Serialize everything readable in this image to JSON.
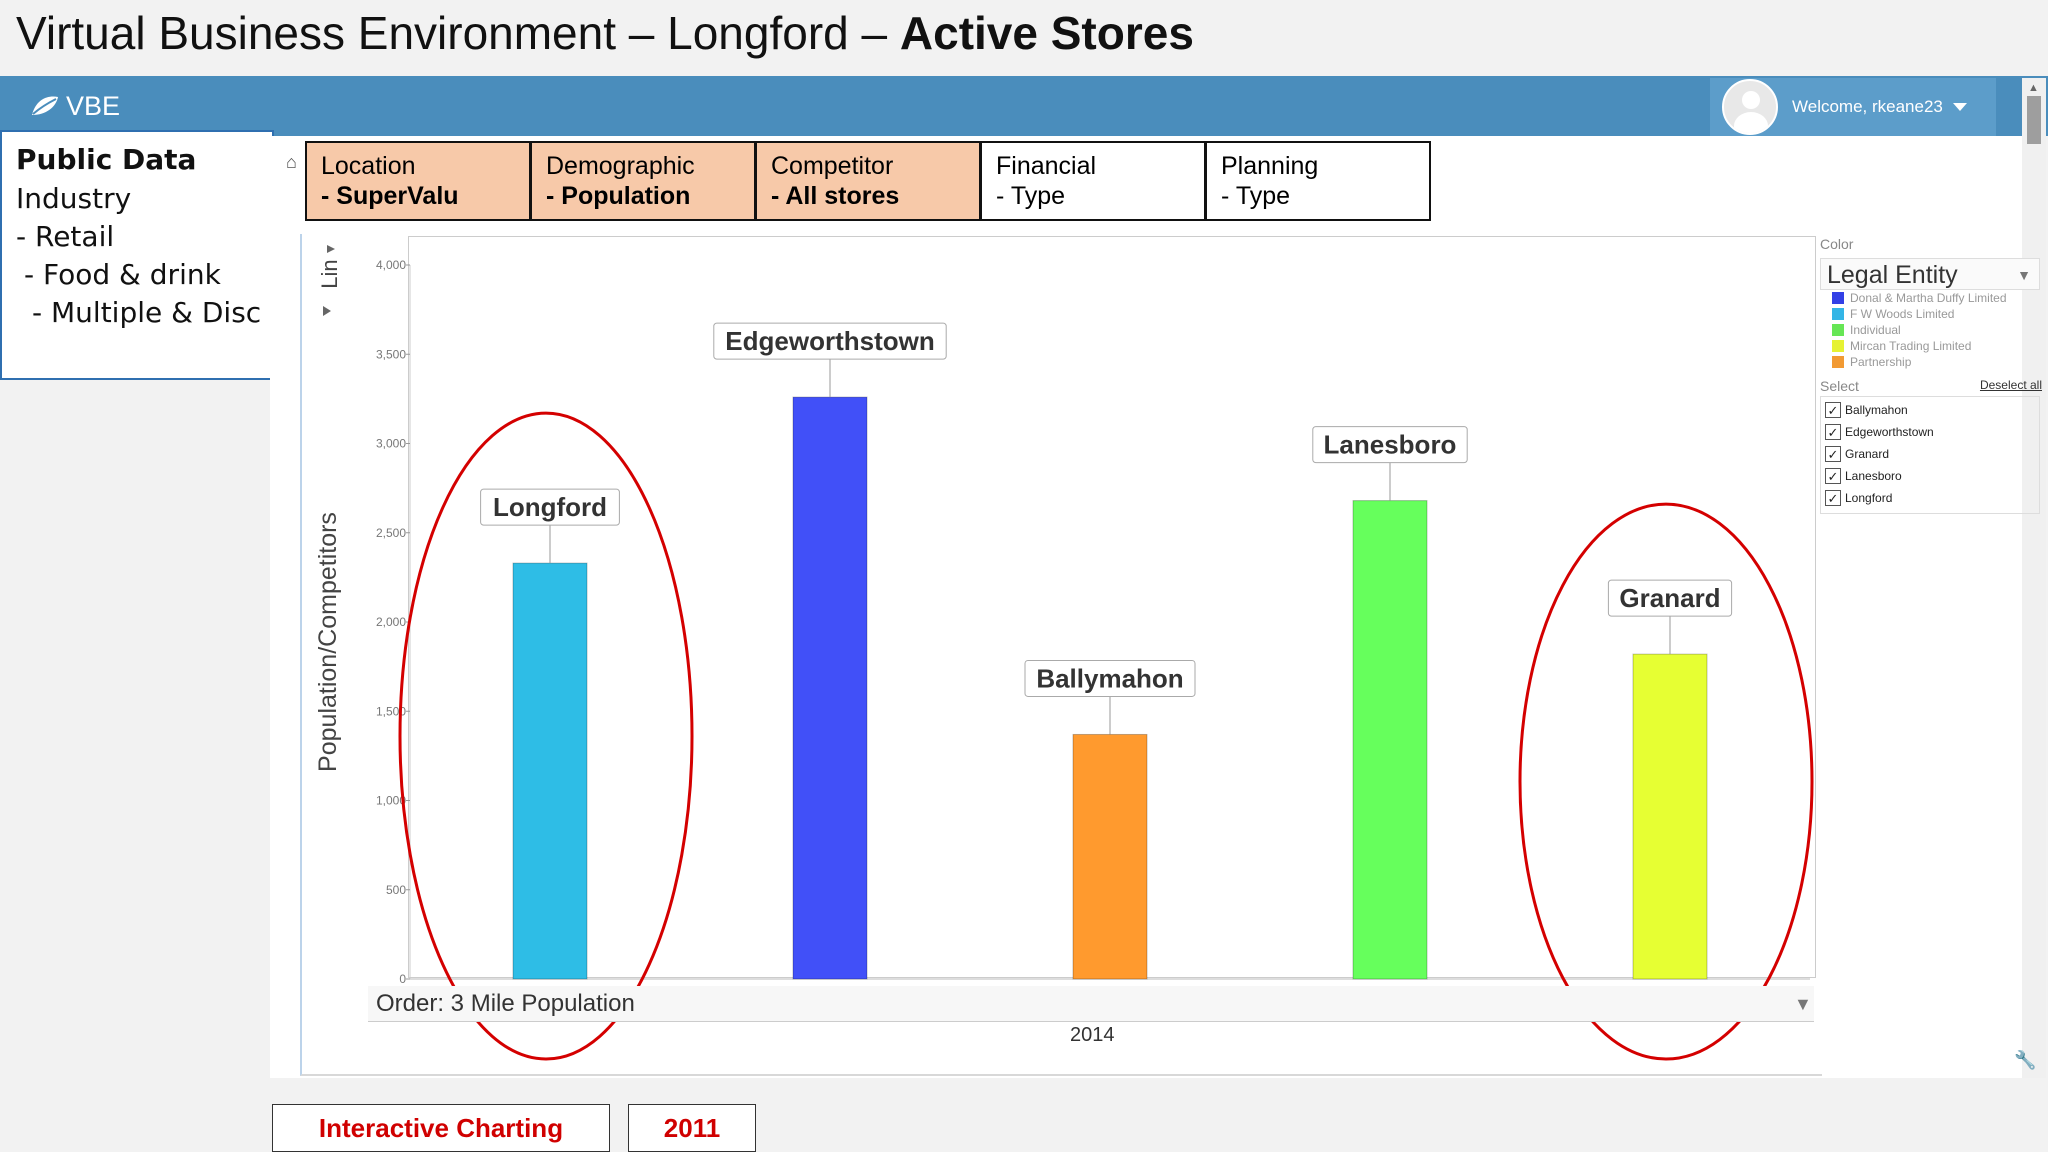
{
  "slide": {
    "title_prefix": "Virtual Business Environment – Longford – ",
    "title_bold": "Active Stores"
  },
  "topbar": {
    "logo_text": "VBE",
    "welcome": "Welcome, rkeane23"
  },
  "public_data": {
    "heading": "Public Data",
    "lines": [
      "Industry",
      "- Retail",
      " - Food & drink",
      "  - Multiple & Disc"
    ]
  },
  "tabs": [
    {
      "label": "Location",
      "value": "- SuperValu"
    },
    {
      "label": "Demographic",
      "value": "- Population"
    },
    {
      "label": "Competitor",
      "value": "- All stores"
    },
    {
      "label": "Financial",
      "value": "- Type"
    },
    {
      "label": "Planning",
      "value": "- Type"
    }
  ],
  "chart_controls": {
    "lin_label": "Lin",
    "order_text": "Order: 3 Mile Population"
  },
  "chart_data": {
    "type": "bar",
    "categories": [
      "Longford",
      "Edgeworthstown",
      "Ballymahon",
      "Lanesboro",
      "Granard"
    ],
    "values": [
      2330,
      3260,
      1370,
      2680,
      1820
    ],
    "colors": [
      "#2ebde6",
      "#4150f8",
      "#ff9a2e",
      "#66ff5c",
      "#e6ff33"
    ],
    "xlabel": "2014",
    "ylabel": "Population/Competitors",
    "ylim": [
      0,
      4000
    ],
    "yticks": [
      "0",
      "500",
      "1,000",
      "1,500",
      "2,000",
      "2,500",
      "3,000",
      "3,500",
      "4,000"
    ],
    "highlighted": [
      "Longford",
      "Granard"
    ],
    "highlight_color": "#d40000",
    "grid": false,
    "legend_position": "right"
  },
  "legend": {
    "color_heading": "Color",
    "color_by": "Legal Entity",
    "entities": [
      {
        "name": "Donal & Martha Duffy Limited",
        "color": "#3340e6"
      },
      {
        "name": "F W Woods Limited",
        "color": "#33b5e6"
      },
      {
        "name": "Individual",
        "color": "#66e655"
      },
      {
        "name": "Mircan Trading Limited",
        "color": "#e6f233"
      },
      {
        "name": "Partnership",
        "color": "#f29a33"
      }
    ],
    "select_heading": "Select",
    "deselect_all": "Deselect all",
    "select_items": [
      "Ballymahon",
      "Edgeworthstown",
      "Granard",
      "Lanesboro",
      "Longford"
    ]
  },
  "bottom_buttons": {
    "charting": "Interactive Charting",
    "year": "2011"
  }
}
